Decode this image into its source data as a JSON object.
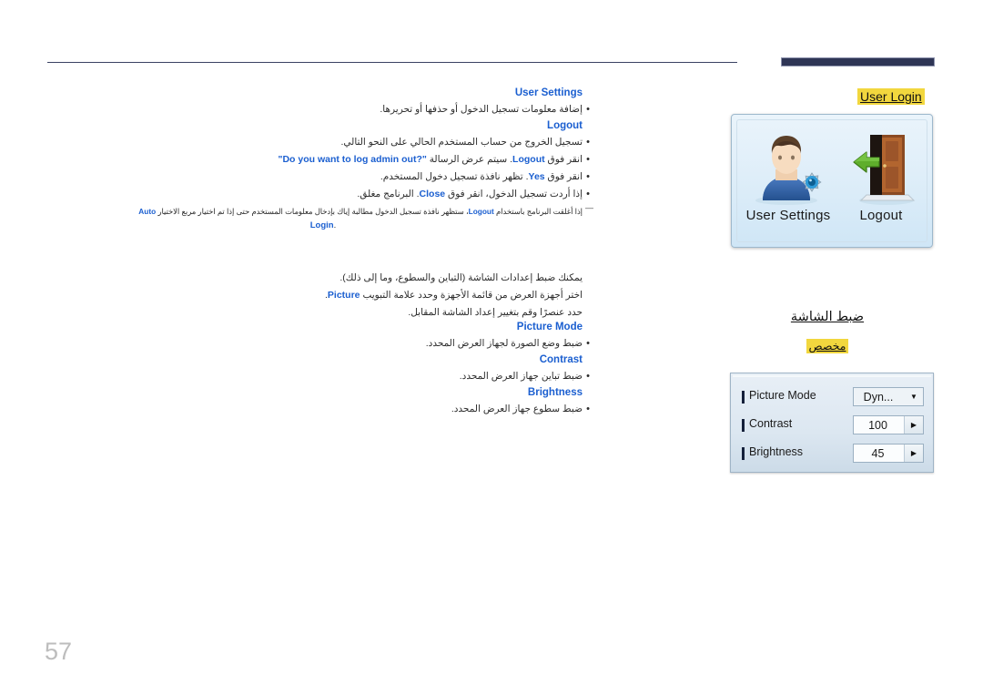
{
  "page": {
    "number": "57"
  },
  "sections": [
    {
      "heading": "User Settings",
      "bullets": [
        {
          "text": "إضافة معلومات تسجيل الدخول أو حذفها أو تحريرها."
        }
      ]
    },
    {
      "heading": "Logout",
      "bullets": [
        {
          "text": "تسجيل الخروج من حساب المستخدم الحالي على النحو التالي."
        },
        {
          "pre": "انقر فوق ",
          "em1": "Logout",
          "mid": ". سيتم عرض الرسالة ",
          "em2": "\"Do you want to log admin out?\""
        },
        {
          "pre": "انقر فوق ",
          "em1": "Yes",
          "mid": ". تظهر نافذة تسجيل دخول المستخدم."
        },
        {
          "pre": "إذا أردت تسجيل الدخول، انقر فوق ",
          "em1": "Close",
          "mid": ". البرنامج مغلق."
        }
      ],
      "note": {
        "pre": "إذا أغلقت البرنامج باستخدام ",
        "em1": "Logout",
        "mid": "، ستظهر نافذة تسجيل الدخول مطالبة إياك بإدخال معلومات المستخدم حتى إذا تم اختيار مربع الاختيار ",
        "em2": "Auto",
        "tail_em": "Login",
        "tail_post": "."
      }
    }
  ],
  "picture_section": {
    "paragraphs": [
      {
        "text": "يمكنك ضبط إعدادات الشاشة (التباين والسطوع، وما إلى ذلك)."
      },
      {
        "pre": "اختر أجهزة العرض من قائمة الأجهزة وحدد علامة التبويب ",
        "em": "Picture",
        "post": "."
      },
      {
        "text": "حدد عنصرًا وقم بتغيير إعداد الشاشة المقابل."
      }
    ],
    "items": [
      {
        "heading": "Picture Mode",
        "bullet": "ضبط وضع الصورة لجهاز العرض المحدد."
      },
      {
        "heading": "Contrast",
        "bullet": "ضبط تباين جهاز العرض المحدد."
      },
      {
        "heading": "Brightness",
        "bullet": "ضبط سطوع جهاز العرض المحدد."
      }
    ]
  },
  "right": {
    "login_caption": "User Login",
    "screenshot": {
      "tiles": [
        {
          "label": "User Settings",
          "icon": "user-settings-icon"
        },
        {
          "label": "Logout",
          "icon": "logout-door-icon"
        }
      ]
    },
    "screen_heading": "ضبط الشاشة",
    "screen_sub": "مخصص",
    "panel": {
      "rows": [
        {
          "label": "Picture Mode",
          "value": "Dyn...",
          "control": "dropdown",
          "arrow": "▼"
        },
        {
          "label": "Contrast",
          "value": "100",
          "control": "stepper",
          "arrow": "▶"
        },
        {
          "label": "Brightness",
          "value": "45",
          "control": "stepper",
          "arrow": "▶"
        }
      ]
    }
  },
  "colors": {
    "accent_blue": "#1b5fd0",
    "navy": "#2e3555",
    "highlight_yellow": "#f2d73e",
    "page_gray": "#bdbdbd"
  }
}
